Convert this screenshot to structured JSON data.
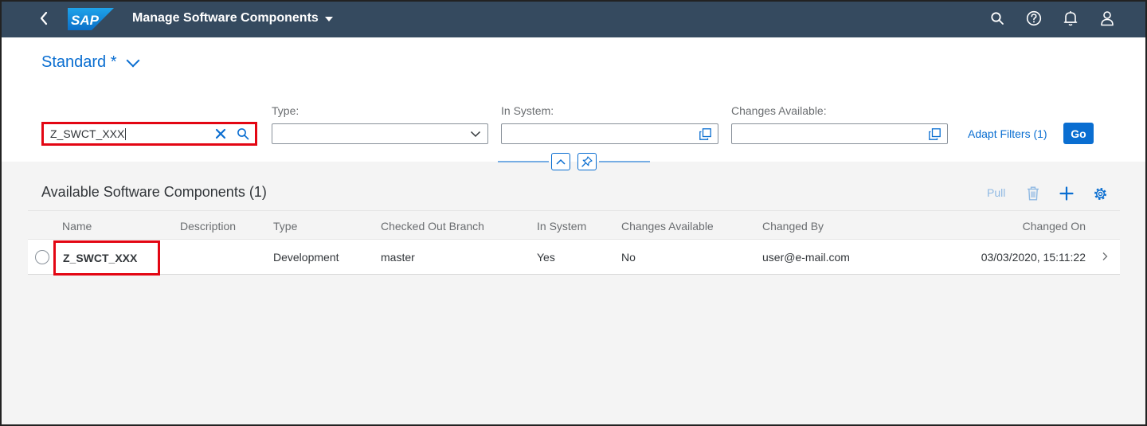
{
  "shell": {
    "app_title": "Manage Software Components",
    "logo_text": "SAP",
    "icons": [
      "back-icon",
      "search-icon",
      "help-icon",
      "bell-icon",
      "user-icon"
    ]
  },
  "header": {
    "variant": "Standard *",
    "search": {
      "value": "Z_SWCT_XXX"
    },
    "filters": [
      {
        "label": "Type:",
        "value": ""
      },
      {
        "label": "In System:",
        "value": ""
      },
      {
        "label": "Changes Available:",
        "value": ""
      }
    ],
    "adapt_filters": "Adapt Filters (1)",
    "go": "Go"
  },
  "table": {
    "title": "Available Software Components (1)",
    "toolbar": {
      "pull": "Pull"
    },
    "columns": [
      "Name",
      "Description",
      "Type",
      "Checked Out Branch",
      "In System",
      "Changes Available",
      "Changed By",
      "Changed On"
    ],
    "rows": [
      {
        "name": "Z_SWCT_XXX",
        "description": "",
        "type": "Development",
        "branch": "master",
        "in_system": "Yes",
        "changes_available": "No",
        "changed_by": "user@e-mail.com",
        "changed_on": "03/03/2020, 15:11:22"
      }
    ]
  },
  "colors": {
    "shell_bg": "#354a5f",
    "accent": "#0a6ed1",
    "highlight": "#e30613"
  }
}
